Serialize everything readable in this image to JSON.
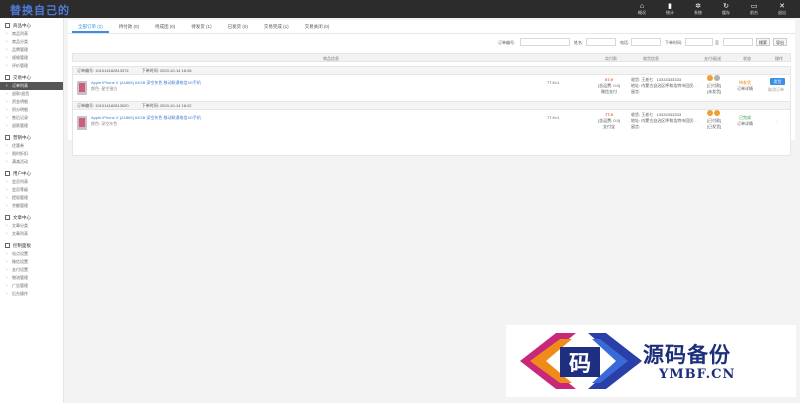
{
  "app": {
    "logo": "替换自己的"
  },
  "toolbar": [
    {
      "icon": "home-icon",
      "glyph": "⌂",
      "label": "概况"
    },
    {
      "icon": "bar-chart-icon",
      "glyph": "▮",
      "label": "统计"
    },
    {
      "icon": "gear-icon",
      "glyph": "✲",
      "label": "系统"
    },
    {
      "icon": "refresh-icon",
      "glyph": "↻",
      "label": "缓存"
    },
    {
      "icon": "monitor-icon",
      "glyph": "▭",
      "label": "前台"
    },
    {
      "icon": "close-icon",
      "glyph": "✕",
      "label": "退出"
    }
  ],
  "sidebar": {
    "groups": [
      {
        "title": "商品中心",
        "items": [
          "商品列表",
          "商品分类",
          "品牌管理",
          "规格管理",
          "评价管理"
        ]
      },
      {
        "title": "交易中心",
        "items": [
          "订单列表",
          "退款/退货",
          "资金明细",
          "积分明细",
          "售后记录",
          "退款管理"
        ]
      },
      {
        "title": "营销中心",
        "items": [
          "优惠券",
          "限时折扣",
          "满减活动"
        ]
      },
      {
        "title": "用户中心",
        "items": [
          "会员列表",
          "会员等级",
          "提现管理",
          "余额管理"
        ]
      },
      {
        "title": "文章中心",
        "items": [
          "文章分类",
          "文章列表"
        ]
      },
      {
        "title": "控制面板",
        "items": [
          "站点设置",
          "微信设置",
          "支付设置",
          "物流管理",
          "广告管理",
          "后台操作"
        ]
      }
    ],
    "active": "订单列表"
  },
  "tabs": [
    {
      "label": "全部订单",
      "count": "(2)",
      "active": true
    },
    {
      "label": "待付款",
      "count": "(0)"
    },
    {
      "label": "待成团",
      "count": "(0)"
    },
    {
      "label": "待发货",
      "count": "(1)"
    },
    {
      "label": "已发货",
      "count": "(0)"
    },
    {
      "label": "交易完成",
      "count": "(1)"
    },
    {
      "label": "交易关闭",
      "count": "(0)"
    }
  ],
  "filters": {
    "order_no_label": "订单编号:",
    "name_label": "姓名:",
    "phone_label": "电话:",
    "time_label": "下单时间:",
    "to": "至",
    "search_button": "搜索",
    "export_button": "导出"
  },
  "table_header": {
    "product": "商品信息",
    "amount": "实付款",
    "receiver": "收货信息",
    "payment": "支付/配送",
    "status": "状态",
    "action": "操作"
  },
  "orders": [
    {
      "order_no": "订单编号: 101014182813374",
      "time": "下单时间: 2020-10-14 18:28",
      "product_name": "Apple iPhone X (A1865) 64GB 深空灰色 移动联通电信4G手机",
      "product_spec": "颜色: 星空银白",
      "price": "77.9×1",
      "total": "67.9",
      "total_note": "(含运费: 0.0)",
      "pay_method": "微信支付",
      "receiver_name": "收货: 王老七",
      "receiver_phone": "13333333333",
      "receiver_addr": "地址: 内蒙古自治区呼和浩特市回民...",
      "receiver_note": "留言:",
      "pay_status": "[已付款]",
      "ship_status": "[未发货]",
      "status": "待发货",
      "status_sub": "订单详情",
      "action_button": "发货",
      "action_link": "取消订单"
    },
    {
      "order_no": "订单编号: 101014182813020",
      "time": "下单时间: 2020-10-14 18:22",
      "product_name": "Apple iPhone X (A1865) 64GB 深空灰色 移动联通电信4G手机",
      "product_spec": "颜色: 深空灰色",
      "price": "77.9×1",
      "total": "77.9",
      "total_note": "(含运费: 0.0)",
      "pay_method": "支付宝",
      "receiver_name": "收货: 王老七",
      "receiver_phone": "13333333333",
      "receiver_addr": "地址: 内蒙古自治区呼和浩特市回民...",
      "receiver_note": "留言:",
      "pay_status": "[已付款]",
      "ship_status": "[已发货]",
      "status": "已完成",
      "status_sub": "订单详情",
      "action_link": "-"
    }
  ],
  "watermark": {
    "cn": "源码备份",
    "en": "YMBF.CN",
    "glyph": "码"
  }
}
